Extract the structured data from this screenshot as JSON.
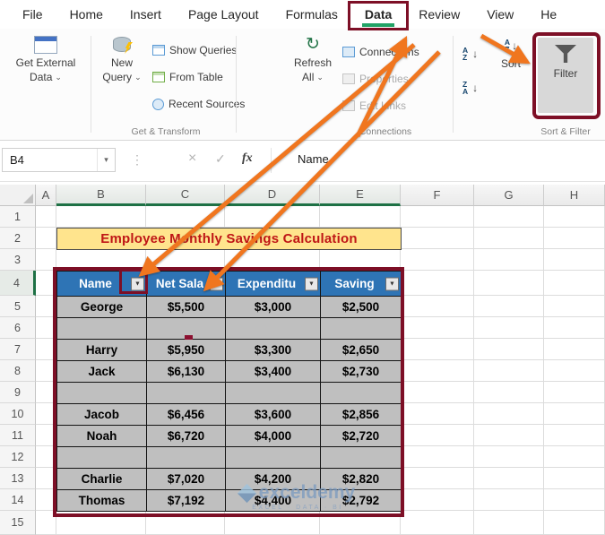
{
  "tabs": {
    "items": [
      {
        "label": "File"
      },
      {
        "label": "Home"
      },
      {
        "label": "Insert"
      },
      {
        "label": "Page Layout"
      },
      {
        "label": "Formulas"
      },
      {
        "label": "Data"
      },
      {
        "label": "Review"
      },
      {
        "label": "View"
      },
      {
        "label": "He"
      }
    ],
    "active": "Data"
  },
  "ribbon": {
    "get_external": {
      "line1": "Get External",
      "line2": "Data"
    },
    "new_query": {
      "line1": "New",
      "line2": "Query"
    },
    "show_queries": "Show Queries",
    "from_table": "From Table",
    "recent_sources": "Recent Sources",
    "refresh": {
      "line1": "Refresh",
      "line2": "All"
    },
    "connections": "Connections",
    "properties": "Properties",
    "edit_links": "Edit Links",
    "sort": "Sort",
    "filter": "Filter",
    "groups": {
      "get_transform": "Get & Transform",
      "connections": "Connections",
      "sort_filter": "Sort & Filter"
    }
  },
  "formula_bar": {
    "name_box": "B4",
    "content": "Name"
  },
  "sheet": {
    "columns": [
      "A",
      "B",
      "C",
      "D",
      "E",
      "F",
      "G",
      "H"
    ],
    "rows": [
      "1",
      "2",
      "3",
      "4",
      "5",
      "6",
      "7",
      "8",
      "9",
      "10",
      "11",
      "12",
      "13",
      "14",
      "15"
    ],
    "title": "Employee Monthly Savings Calculation",
    "table": {
      "headers": [
        "Name",
        "Net Sala",
        "Expenditu",
        "Saving"
      ],
      "rows": [
        [
          "George",
          "$5,500",
          "$3,000",
          "$2,500"
        ],
        [
          "",
          "",
          "",
          ""
        ],
        [
          "Harry",
          "$5,950",
          "$3,300",
          "$2,650"
        ],
        [
          "Jack",
          "$6,130",
          "$3,400",
          "$2,730"
        ],
        [
          "",
          "",
          "",
          ""
        ],
        [
          "Jacob",
          "$6,456",
          "$3,600",
          "$2,856"
        ],
        [
          "Noah",
          "$6,720",
          "$4,000",
          "$2,720"
        ],
        [
          "",
          "",
          "",
          ""
        ],
        [
          "Charlie",
          "$7,020",
          "$4,200",
          "$2,820"
        ],
        [
          "Thomas",
          "$7,192",
          "$4,400",
          "$2,792"
        ]
      ]
    }
  },
  "watermark": {
    "brand": "exceldemy",
    "tagline": "EXCEL · DATA · BI"
  },
  "icons": {
    "chevron_down": "⌄",
    "filter_dropdown": "▼",
    "name_box_arrow": "▾",
    "cancel": "×",
    "check": "✓",
    "fx": "fx",
    "refresh": "↻",
    "sort_down_arrow": "↓",
    "ellipsis": "⋮",
    "sort_letters": {
      "a": "A",
      "z": "Z"
    }
  },
  "colors": {
    "highlight_maroon": "#7d0f26",
    "arrow_orange": "#f0761f",
    "table_header_blue": "#2e74b5",
    "table_cell_gray": "#bfbfbf",
    "title_bg_yellow": "#ffe48d",
    "title_text_red": "#bf1616",
    "active_tab_green": "#21a366"
  }
}
